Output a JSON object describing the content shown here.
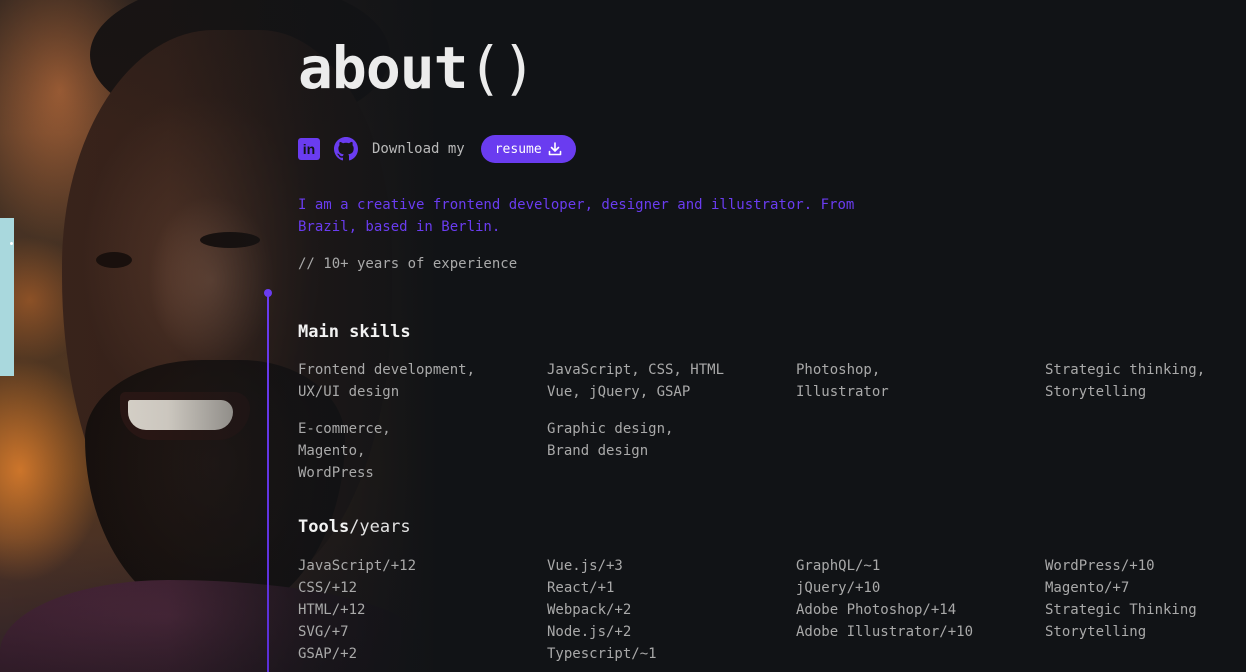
{
  "title": {
    "word": "about",
    "parens": "()"
  },
  "social": {
    "linkedin_icon_glyph": "in",
    "download_label": "Download my",
    "resume_label": "resume"
  },
  "intro": "I am a creative frontend developer, designer and illustrator. From Brazil, based in Berlin.",
  "experience": "// 10+ years of experience",
  "skills": {
    "heading": "Main skills",
    "items": [
      "Frontend development,\nUX/UI design",
      "JavaScript, CSS, HTML\nVue, jQuery, GSAP",
      "Photoshop,\nIllustrator",
      "Strategic thinking,\nStorytelling",
      "E-commerce,\nMagento,\nWordPress",
      "Graphic design,\nBrand design"
    ]
  },
  "tools": {
    "heading_bold": "Tools",
    "heading_light": "/years",
    "columns": [
      [
        "JavaScript/+12",
        "CSS/+12",
        "HTML/+12",
        "SVG/+7",
        "GSAP/+2"
      ],
      [
        "Vue.js/+3",
        "React/+1",
        "Webpack/+2",
        "Node.js/+2",
        "Typescript/~1"
      ],
      [
        "GraphQL/~1",
        "jQuery/+10",
        "Adobe Photoshop/+14",
        "Adobe Illustrator/+10"
      ],
      [
        "WordPress/+10",
        "Magento/+7",
        "Strategic Thinking",
        "Storytelling"
      ]
    ]
  },
  "colors": {
    "accent": "#6a3cf0",
    "background": "#111316",
    "text_muted": "#a9a9a9",
    "side_tab": "#a9d8dd"
  }
}
